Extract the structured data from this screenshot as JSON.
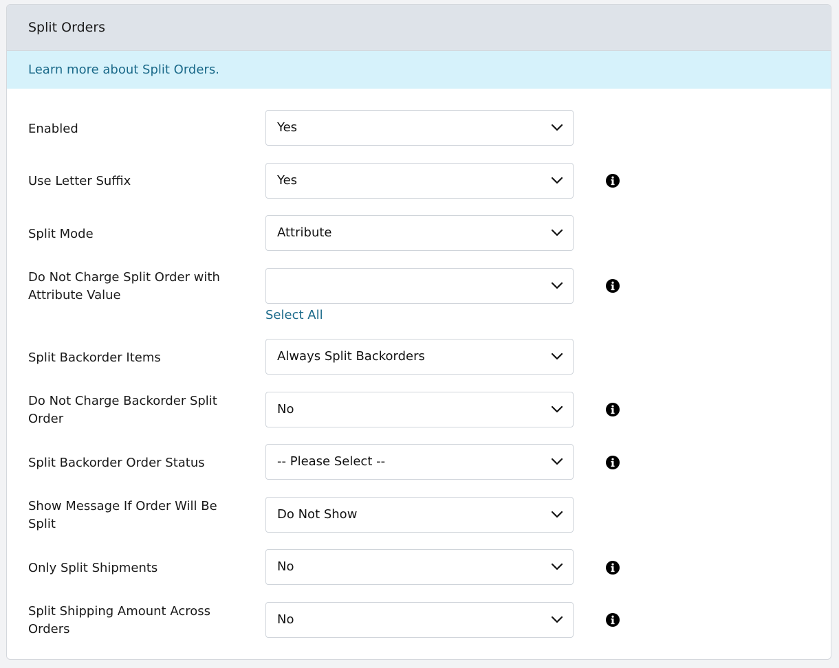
{
  "panel": {
    "title": "Split Orders",
    "learn_more_link": "Learn more about Split Orders."
  },
  "fields": [
    {
      "label": "Enabled",
      "value": "Yes",
      "has_info": false
    },
    {
      "label": "Use Letter Suffix",
      "value": "Yes",
      "has_info": true
    },
    {
      "label": "Split Mode",
      "value": "Attribute",
      "has_info": false
    },
    {
      "label": "Do Not Charge Split Order with Attribute Value",
      "value": "",
      "has_info": true,
      "extra_link": "Select All"
    },
    {
      "label": "Split Backorder Items",
      "value": "Always Split Backorders",
      "has_info": false
    },
    {
      "label": "Do Not Charge Backorder Split Order",
      "value": "No",
      "has_info": true
    },
    {
      "label": "Split Backorder Order Status",
      "value": "-- Please Select --",
      "has_info": true
    },
    {
      "label": "Show Message If Order Will Be Split",
      "value": "Do Not Show",
      "has_info": false
    },
    {
      "label": "Only Split Shipments",
      "value": "No",
      "has_info": true
    },
    {
      "label": "Split Shipping Amount Across Orders",
      "value": "No",
      "has_info": true
    }
  ],
  "icons": {
    "dropdown": "chevron-down-icon",
    "info": "info-icon"
  },
  "colors": {
    "header_bg": "#dee3e9",
    "info_bg": "#d6f2fb",
    "link": "#1b6a8a"
  }
}
